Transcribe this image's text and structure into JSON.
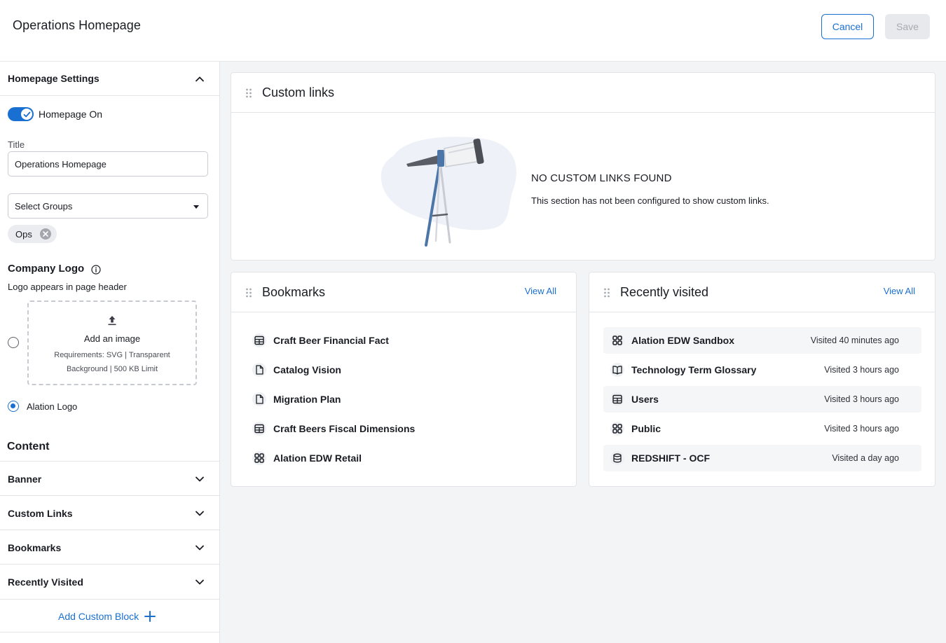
{
  "header": {
    "title": "Operations Homepage",
    "cancel_label": "Cancel",
    "save_label": "Save"
  },
  "sidebar": {
    "settings_title": "Homepage Settings",
    "toggle_label": "Homepage On",
    "title_label": "Title",
    "title_value": "Operations Homepage",
    "groups_placeholder": "Select Groups",
    "group_chip": "Ops",
    "logo_heading": "Company Logo",
    "logo_desc": "Logo appears in page header",
    "dropzone_title": "Add an image",
    "dropzone_req_1": "Requirements: SVG | Transparent",
    "dropzone_req_2": "Background | 500 KB Limit",
    "alation_logo_label": "Alation Logo",
    "content_heading": "Content",
    "sections": [
      {
        "label": "Banner"
      },
      {
        "label": "Custom Links"
      },
      {
        "label": "Bookmarks"
      },
      {
        "label": "Recently Visited"
      }
    ],
    "add_block_label": "Add Custom Block"
  },
  "custom_links": {
    "title": "Custom links",
    "empty_title": "NO CUSTOM LINKS FOUND",
    "empty_desc": "This section has not been configured to show custom links."
  },
  "bookmarks": {
    "title": "Bookmarks",
    "view_all": "View All",
    "items": [
      {
        "label": "Craft Beer Financial Fact",
        "icon": "table-icon"
      },
      {
        "label": "Catalog Vision",
        "icon": "document-icon"
      },
      {
        "label": "Migration Plan",
        "icon": "document-icon"
      },
      {
        "label": "Craft Beers Fiscal Dimensions",
        "icon": "table-icon"
      },
      {
        "label": "Alation EDW Retail",
        "icon": "schema-icon"
      }
    ]
  },
  "recent": {
    "title": "Recently visited",
    "view_all": "View All",
    "items": [
      {
        "label": "Alation EDW Sandbox",
        "meta": "Visited 40 minutes ago",
        "icon": "schema-icon"
      },
      {
        "label": "Technology Term Glossary",
        "meta": "Visited 3 hours ago",
        "icon": "book-icon"
      },
      {
        "label": "Users",
        "meta": "Visited 3 hours ago",
        "icon": "table-icon"
      },
      {
        "label": "Public",
        "meta": "Visited 3 hours ago",
        "icon": "schema-icon"
      },
      {
        "label": "REDSHIFT - OCF",
        "meta": "Visited a day ago",
        "icon": "database-icon"
      }
    ]
  },
  "colors": {
    "accent": "#1a6fd3",
    "text": "#1a1c23",
    "border": "#e3e4e8",
    "background": "#f3f4f6"
  }
}
